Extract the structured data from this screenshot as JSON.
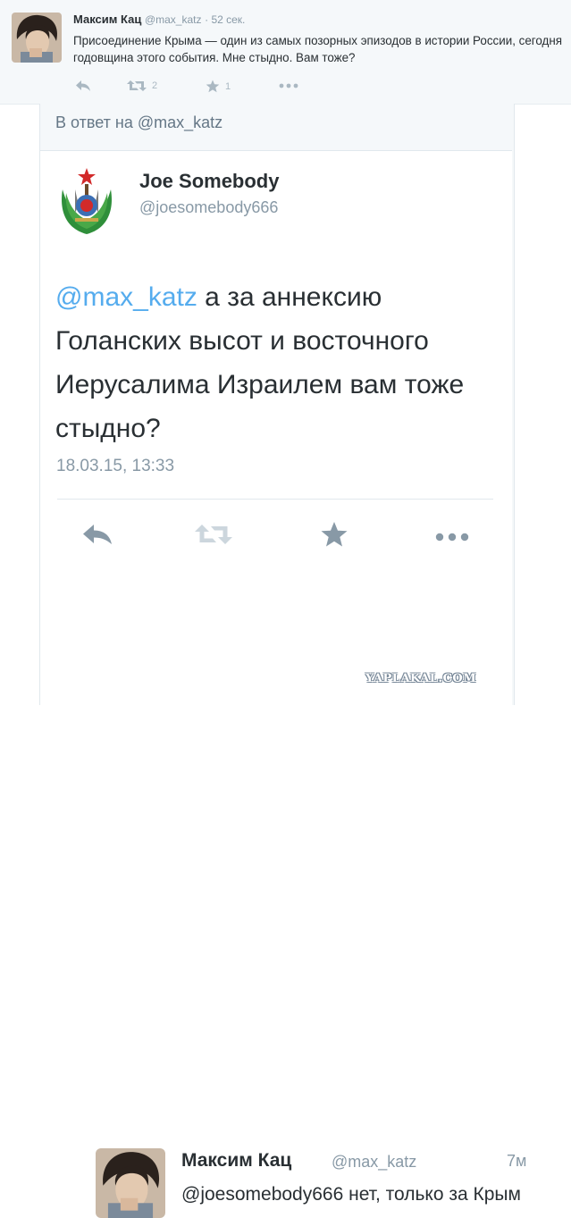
{
  "top_tweet": {
    "author_name": "Максим Кац",
    "author_handle": "@max_katz",
    "time": "· 52 сек.",
    "text": "Присоединение Крыма — один из самых позорных эпизодов в истории России, сегодня годовщина этого события. Мне стыдно. Вам тоже?",
    "retweet_count": "2",
    "favorite_count": "1",
    "icons": [
      "reply-icon",
      "retweet-icon",
      "favorite-icon",
      "more-icon"
    ]
  },
  "reply_card": {
    "in_reply_to": "В ответ на @max_katz",
    "author_name": "Joe Somebody",
    "author_handle": "@joesomebody666",
    "mention": "@max_katz",
    "text": " а за аннексию Голанских высот и восточного Иерусалима Израилем вам тоже стыдно?",
    "timestamp": "18.03.15, 13:33",
    "icons": [
      "reply-icon",
      "retweet-icon",
      "favorite-icon",
      "more-icon"
    ]
  },
  "answer": {
    "author_name": "Максим Кац",
    "author_handle": "@max_katz",
    "time": "7м",
    "text": "@joesomebody666 нет, только за Крым"
  },
  "watermark": "YAPLAKAL.COM",
  "colors": {
    "link": "#55acee",
    "muted": "#8899a6",
    "icon": "#aab8c2",
    "text": "#292f33",
    "background": "#f5f8fa"
  }
}
